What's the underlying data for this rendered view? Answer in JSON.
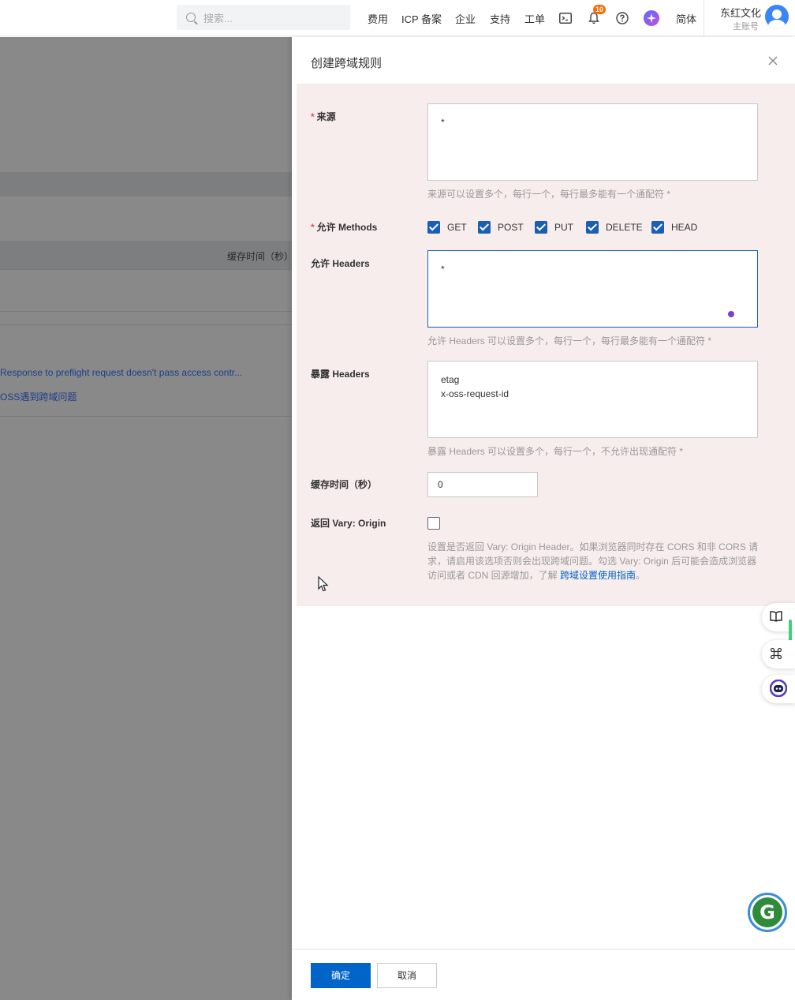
{
  "topbar": {
    "search_placeholder": "搜索...",
    "nav": [
      "费用",
      "ICP 备案",
      "企业",
      "支持",
      "工单"
    ],
    "notification_count": "10",
    "language": "简体",
    "user_name": "东红文化",
    "user_role": "主账号"
  },
  "background_page": {
    "column_header": "缓存时间（秒）",
    "faq_items": [
      "Response to preflight request doesn't pass access contr...",
      "OSS遇到跨域问题"
    ]
  },
  "drawer": {
    "title": "创建跨域规则",
    "fields": {
      "origin": {
        "label": "来源",
        "required": true,
        "value": "*",
        "hint": "来源可以设置多个，每行一个，每行最多能有一个通配符 *"
      },
      "methods": {
        "label": "允许 Methods",
        "required": true,
        "options": [
          {
            "label": "GET",
            "checked": true
          },
          {
            "label": "POST",
            "checked": true
          },
          {
            "label": "PUT",
            "checked": true
          },
          {
            "label": "DELETE",
            "checked": true
          },
          {
            "label": "HEAD",
            "checked": true
          }
        ]
      },
      "allow_headers": {
        "label": "允许 Headers",
        "value": "*",
        "hint": "允许 Headers 可以设置多个，每行一个，每行最多能有一个通配符 *"
      },
      "expose_headers": {
        "label": "暴露 Headers",
        "value": "etag\nx-oss-request-id",
        "hint": "暴露 Headers 可以设置多个，每行一个，不允许出现通配符 *"
      },
      "max_age": {
        "label": "缓存时间（秒）",
        "value": "0"
      },
      "vary_origin": {
        "label": "返回 Vary: Origin",
        "checked": false,
        "hint": "设置是否返回 Vary: Origin Header。如果浏览器同时存在 CORS 和非 CORS 请求，请启用该选项否则会出现跨域问题。勾选 Vary: Origin 后可能会造成浏览器访问或者 CDN 回源增加，了解 ",
        "hint_link": "跨域设置使用指南",
        "hint_end": "。"
      }
    },
    "buttons": {
      "ok": "确定",
      "cancel": "取消"
    }
  },
  "colors": {
    "primary": "#0064c8",
    "checkbox": "#1a5fb4",
    "required": "#e34d59",
    "form_bg": "#f8eded",
    "overlay": "#898989"
  },
  "icons": [
    "search-icon",
    "terminal-icon",
    "bell-icon",
    "help-icon",
    "ai-assistant-icon",
    "close-icon",
    "book-icon",
    "command-icon",
    "robot-icon",
    "grammarly-icon",
    "mouse-cursor-icon"
  ]
}
